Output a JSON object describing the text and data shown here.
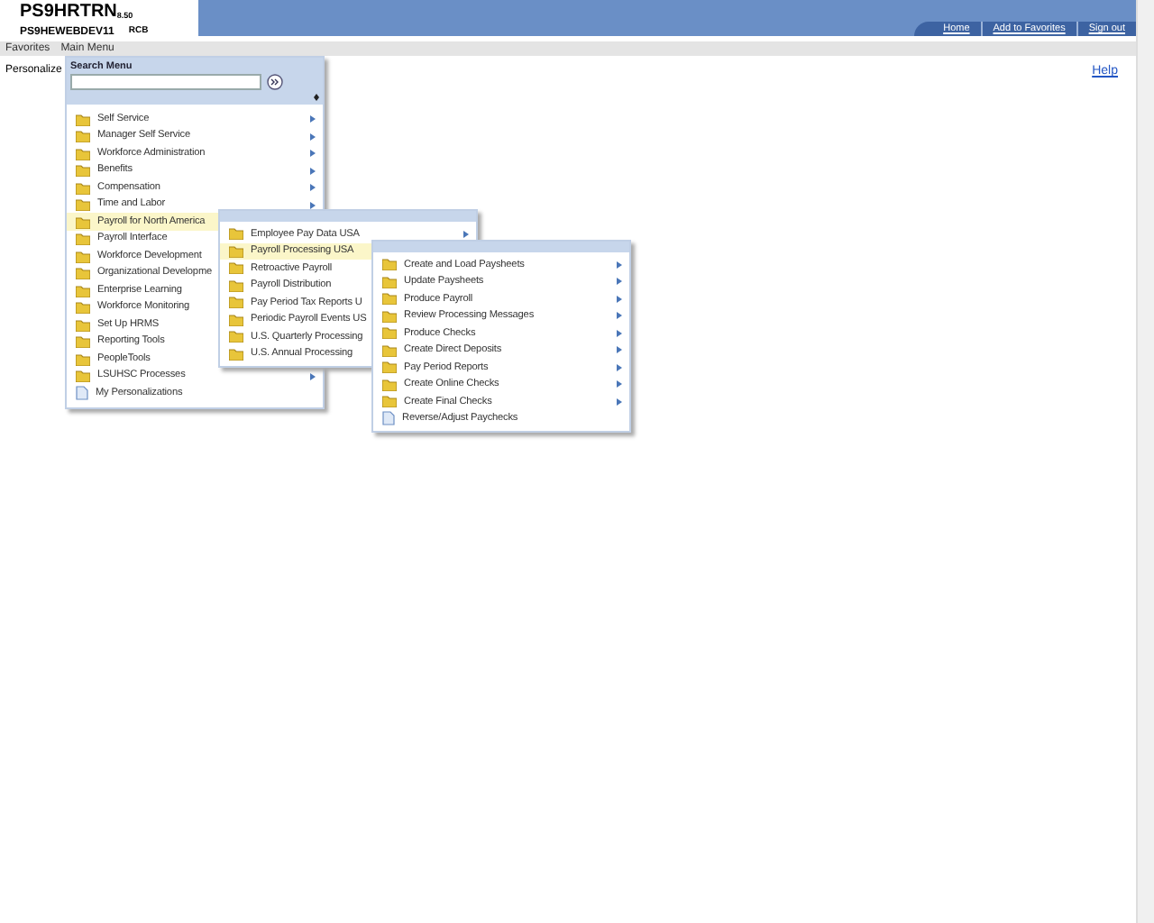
{
  "header": {
    "title": "PS9HRTRN",
    "version": "8.50",
    "server": "PS9HEWEBDEV11",
    "user": "RCB",
    "links": [
      "Home",
      "Add to Favorites",
      "Sign out"
    ]
  },
  "menubar": [
    {
      "label": "Favorites"
    },
    {
      "label": "Main Menu"
    }
  ],
  "page": {
    "title": "Personalize",
    "help": "Help"
  },
  "main_menu": {
    "title": "Search Menu",
    "items": [
      {
        "label": "Self Service",
        "kind": "folder",
        "arrow": true,
        "selected": false
      },
      {
        "label": "Manager Self Service",
        "kind": "folder",
        "arrow": true,
        "selected": false
      },
      {
        "label": "Workforce Administration",
        "kind": "folder",
        "arrow": true,
        "selected": false
      },
      {
        "label": "Benefits",
        "kind": "folder",
        "arrow": true,
        "selected": false
      },
      {
        "label": "Compensation",
        "kind": "folder",
        "arrow": true,
        "selected": false
      },
      {
        "label": "Time and Labor",
        "kind": "folder",
        "arrow": true,
        "selected": false
      },
      {
        "label": "Payroll for North America",
        "kind": "folder",
        "arrow": false,
        "selected": true
      },
      {
        "label": "Payroll Interface",
        "kind": "folder",
        "arrow": false,
        "selected": false
      },
      {
        "label": "Workforce Development",
        "kind": "folder",
        "arrow": false,
        "selected": false
      },
      {
        "label": "Organizational Developme",
        "kind": "folder",
        "arrow": false,
        "selected": false
      },
      {
        "label": "Enterprise Learning",
        "kind": "folder",
        "arrow": false,
        "selected": false
      },
      {
        "label": "Workforce Monitoring",
        "kind": "folder",
        "arrow": false,
        "selected": false
      },
      {
        "label": "Set Up HRMS",
        "kind": "folder",
        "arrow": false,
        "selected": false
      },
      {
        "label": "Reporting Tools",
        "kind": "folder",
        "arrow": false,
        "selected": false
      },
      {
        "label": "PeopleTools",
        "kind": "folder",
        "arrow": false,
        "selected": false
      },
      {
        "label": "LSUHSC Processes",
        "kind": "folder",
        "arrow": true,
        "selected": false
      },
      {
        "label": "My Personalizations",
        "kind": "page",
        "arrow": false,
        "selected": false
      }
    ]
  },
  "submenu_1": {
    "items": [
      {
        "label": "Employee Pay Data USA",
        "kind": "folder",
        "arrow": true,
        "selected": false
      },
      {
        "label": "Payroll Processing USA",
        "kind": "folder",
        "arrow": false,
        "selected": true
      },
      {
        "label": "Retroactive Payroll",
        "kind": "folder",
        "arrow": false,
        "selected": false
      },
      {
        "label": "Payroll Distribution",
        "kind": "folder",
        "arrow": false,
        "selected": false
      },
      {
        "label": "Pay Period Tax Reports U",
        "kind": "folder",
        "arrow": false,
        "selected": false
      },
      {
        "label": "Periodic Payroll Events US",
        "kind": "folder",
        "arrow": false,
        "selected": false
      },
      {
        "label": "U.S. Quarterly Processing",
        "kind": "folder",
        "arrow": false,
        "selected": false
      },
      {
        "label": "U.S. Annual Processing",
        "kind": "folder",
        "arrow": false,
        "selected": false
      }
    ]
  },
  "submenu_2": {
    "items": [
      {
        "label": "Create and Load Paysheets",
        "kind": "folder",
        "arrow": true,
        "selected": false
      },
      {
        "label": "Update Paysheets",
        "kind": "folder",
        "arrow": true,
        "selected": false
      },
      {
        "label": "Produce Payroll",
        "kind": "folder",
        "arrow": true,
        "selected": false
      },
      {
        "label": "Review Processing Messages",
        "kind": "folder",
        "arrow": true,
        "selected": false
      },
      {
        "label": "Produce Checks",
        "kind": "folder",
        "arrow": true,
        "selected": false
      },
      {
        "label": "Create Direct Deposits",
        "kind": "folder",
        "arrow": true,
        "selected": false
      },
      {
        "label": "Pay Period Reports",
        "kind": "folder",
        "arrow": true,
        "selected": false
      },
      {
        "label": "Create Online Checks",
        "kind": "folder",
        "arrow": true,
        "selected": false
      },
      {
        "label": "Create Final Checks",
        "kind": "folder",
        "arrow": true,
        "selected": false
      },
      {
        "label": "Reverse/Adjust Paychecks",
        "kind": "page",
        "arrow": false,
        "selected": false
      }
    ]
  }
}
